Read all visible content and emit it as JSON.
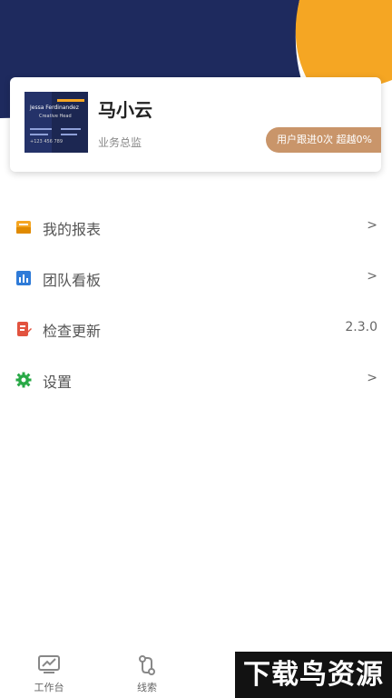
{
  "profile": {
    "name": "马小云",
    "role": "业务总监",
    "badge": "用户跟进0次  超越0%",
    "avatar_card": {
      "name_line": "Jessa Ferdinandez",
      "title_line": "Creative Head",
      "phone": "+123 456 789"
    }
  },
  "menu": [
    {
      "label": "我的报表",
      "value": ">",
      "icon": "report-icon"
    },
    {
      "label": "团队看板",
      "value": ">",
      "icon": "team-board-icon"
    },
    {
      "label": "检查更新",
      "value": "2.3.0",
      "icon": "update-icon"
    },
    {
      "label": "设置",
      "value": ">",
      "icon": "gear-icon"
    }
  ],
  "tabs": [
    {
      "label": "工作台",
      "icon": "workbench-icon"
    },
    {
      "label": "线索",
      "icon": "leads-icon"
    }
  ],
  "watermark": "下载鸟资源",
  "colors": {
    "navy": "#1e2a5e",
    "orange": "#f5a623",
    "badge": "#c9956a"
  }
}
